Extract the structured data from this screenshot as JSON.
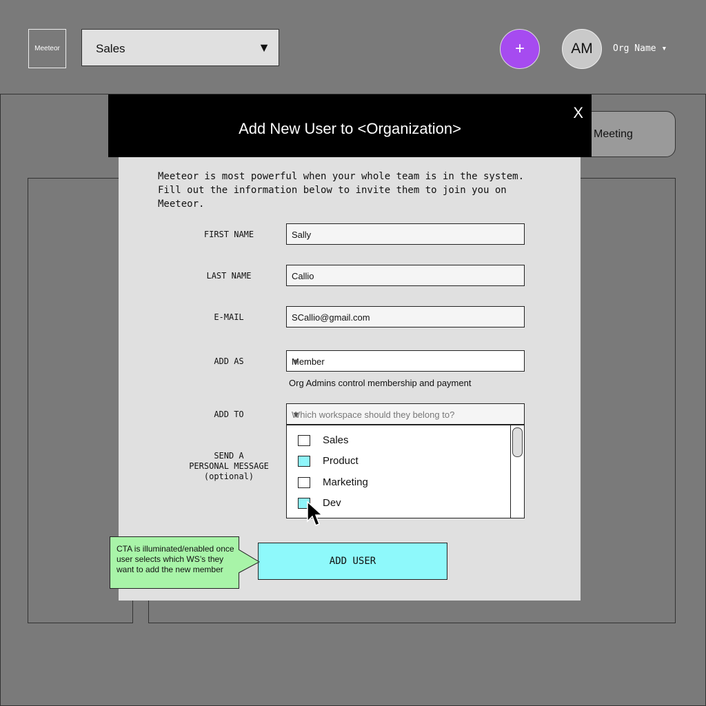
{
  "header": {
    "logo_text": "Meeteor",
    "workspace_selected": "Sales",
    "workspace_arrow": "▼",
    "add_button_label": "+",
    "avatar_initials": "AM",
    "org_menu_label": "Org Name ▾"
  },
  "background": {
    "meeting_button_label": "Meeting"
  },
  "modal": {
    "title": "Add New User to <Organization>",
    "close_label": "X",
    "intro": "Meeteor is most powerful when your whole team is in the system. Fill out the information below to invite them to join you on Meeteor.",
    "fields": {
      "first_name_label": "FIRST NAME",
      "first_name_value": "Sally",
      "last_name_label": "LAST NAME",
      "last_name_value": "Callio",
      "email_label": "E-MAIL",
      "email_value": "SCallio@gmail.com",
      "add_as_label": "ADD AS",
      "add_as_value": "Member",
      "add_as_hint": "Org Admins control membership and payment",
      "add_to_label": "ADD TO",
      "add_to_placeholder": "Which workspace should they belong to?",
      "message_label_line1": "SEND A",
      "message_label_line2": "PERSONAL MESSAGE",
      "message_label_line3": "(optional)"
    },
    "workspace_options": [
      {
        "label": "Sales",
        "checked": false
      },
      {
        "label": "Product",
        "checked": true
      },
      {
        "label": "Marketing",
        "checked": false
      },
      {
        "label": "Dev",
        "checked": true
      }
    ],
    "cta_label": "ADD USER"
  },
  "annotation": {
    "note": "CTA is illuminated/enabled once user selects which WS’s they want to add the new member"
  },
  "colors": {
    "accent_purple": "#a64bf0",
    "cta_cyan": "#8ef9fb",
    "note_green": "#a8f4a8"
  }
}
